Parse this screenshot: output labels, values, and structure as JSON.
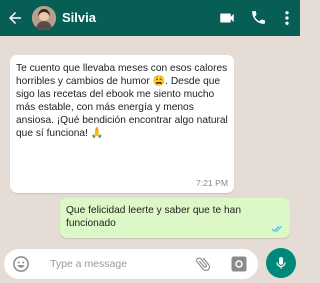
{
  "header": {
    "contact_name": "Silvia",
    "back_icon": "arrow-left-icon",
    "video_icon": "video-camera-icon",
    "call_icon": "phone-icon",
    "menu_icon": "kebab-menu-icon"
  },
  "messages": [
    {
      "direction": "incoming",
      "text_1": "Te cuento que llevaba meses con esos calores horribles y cambios de humor ",
      "emoji_1": "😩",
      "text_2": ". Desde que sigo las recetas del ebook me siento mucho más estable, con más energía y menos ansiosa. ¡Qué bendición encontrar algo natural que sí funciona! ",
      "emoji_2": "🙏",
      "time": "7:21 PM"
    },
    {
      "direction": "outgoing",
      "text": "Que felicidad leerte y saber que te han funcionado",
      "status": "read"
    }
  ],
  "composer": {
    "placeholder": "Type a message",
    "emoji_icon": "emoji-icon",
    "attach_icon": "paperclip-icon",
    "camera_icon": "camera-icon",
    "mic_icon": "microphone-icon"
  },
  "colors": {
    "header": "#075e54",
    "background": "#e5ddd5",
    "outgoing_bubble": "#dcf8c6",
    "read_ticks": "#4fc3f7",
    "mic_button": "#00897b"
  }
}
